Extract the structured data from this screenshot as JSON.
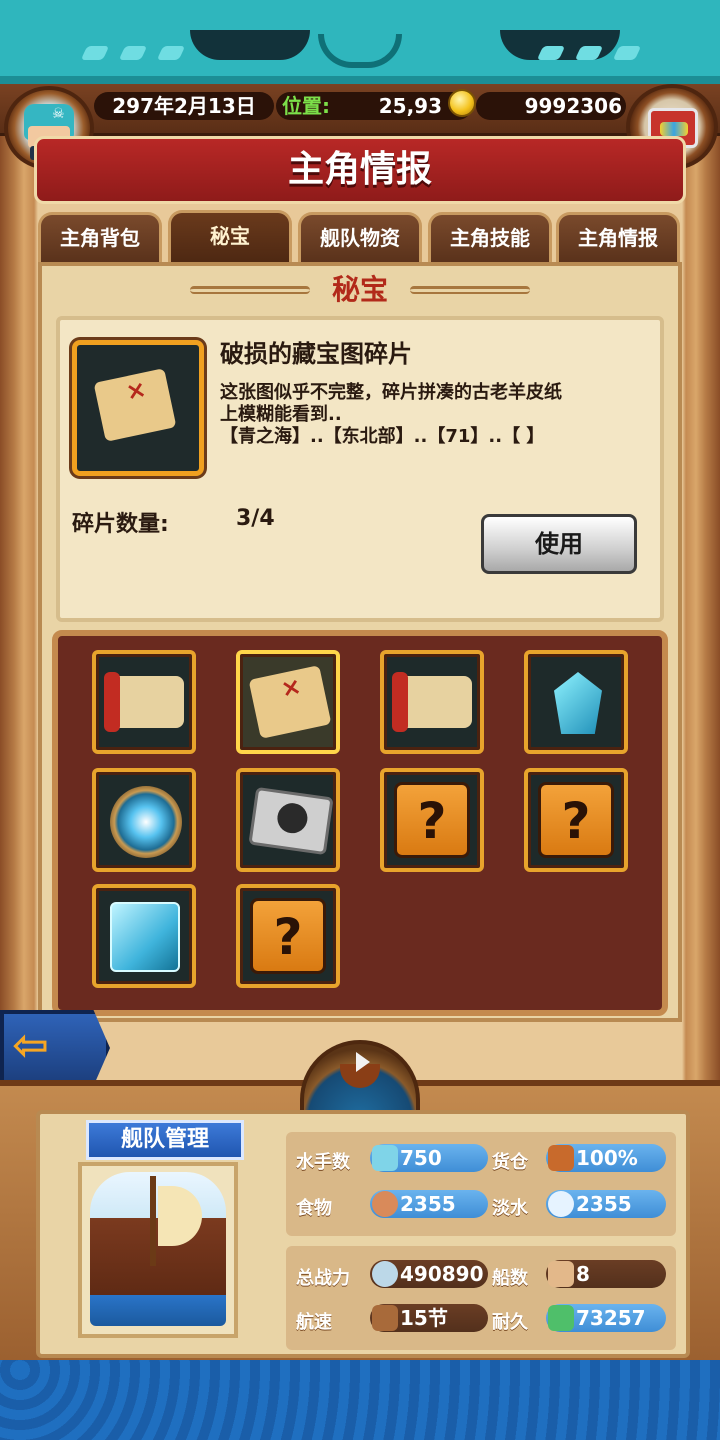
{
  "hud": {
    "date": "297年2月13日",
    "position_label": "位置:",
    "position_value": "25,93",
    "gold": "9992306"
  },
  "title": "主角情报",
  "tabs": [
    {
      "label": "主角背包"
    },
    {
      "label": "秘宝"
    },
    {
      "label": "舰队物资"
    },
    {
      "label": "主角技能"
    },
    {
      "label": "主角情报"
    }
  ],
  "active_tab": "秘宝",
  "section_title": "秘宝",
  "item": {
    "name": "破损的藏宝图碎片",
    "desc_line1": "这张图似乎不完整，碎片拼凑的古老羊皮纸",
    "desc_line2": "上模糊能看到..",
    "desc_line3": "【青之海】..【东北部】..【71】..【 】",
    "count_label": "碎片数量:",
    "count_value": "3/4",
    "use_label": "使用"
  },
  "grid": [
    {
      "name": "scroll-map-item",
      "kind": "scroll"
    },
    {
      "name": "treasure-map-fragment-item",
      "kind": "map",
      "selected": true
    },
    {
      "name": "ancient-scroll-item",
      "kind": "scroll"
    },
    {
      "name": "blue-crystal-item",
      "kind": "crystal"
    },
    {
      "name": "compass-item",
      "kind": "compass"
    },
    {
      "name": "mechanical-device-item",
      "kind": "device"
    },
    {
      "name": "unknown-item",
      "kind": "unknown",
      "symbol": "?"
    },
    {
      "name": "unknown-item",
      "kind": "unknown",
      "symbol": "?"
    },
    {
      "name": "ice-cube-item",
      "kind": "cube"
    },
    {
      "name": "unknown-item",
      "kind": "unknown",
      "symbol": "?"
    }
  ],
  "fleet": {
    "label": "舰队管理",
    "stats": {
      "sailors_label": "水手数",
      "sailors": "750",
      "cargo_label": "货仓",
      "cargo": "100%",
      "food_label": "食物",
      "food": "2355",
      "water_label": "淡水",
      "water": "2355",
      "power_label": "总战力",
      "power": "490890",
      "ships_label": "船数",
      "ships": "8",
      "speed_label": "航速",
      "speed": "15节",
      "durability_label": "耐久",
      "durability": "73257"
    }
  },
  "colors": {
    "accent_red": "#b82826",
    "panel_bg": "#e9d4a6",
    "frame_wood": "#8a4d27",
    "pill_blue": "#3f8ed6",
    "tile_orange": "#e8a42c"
  }
}
